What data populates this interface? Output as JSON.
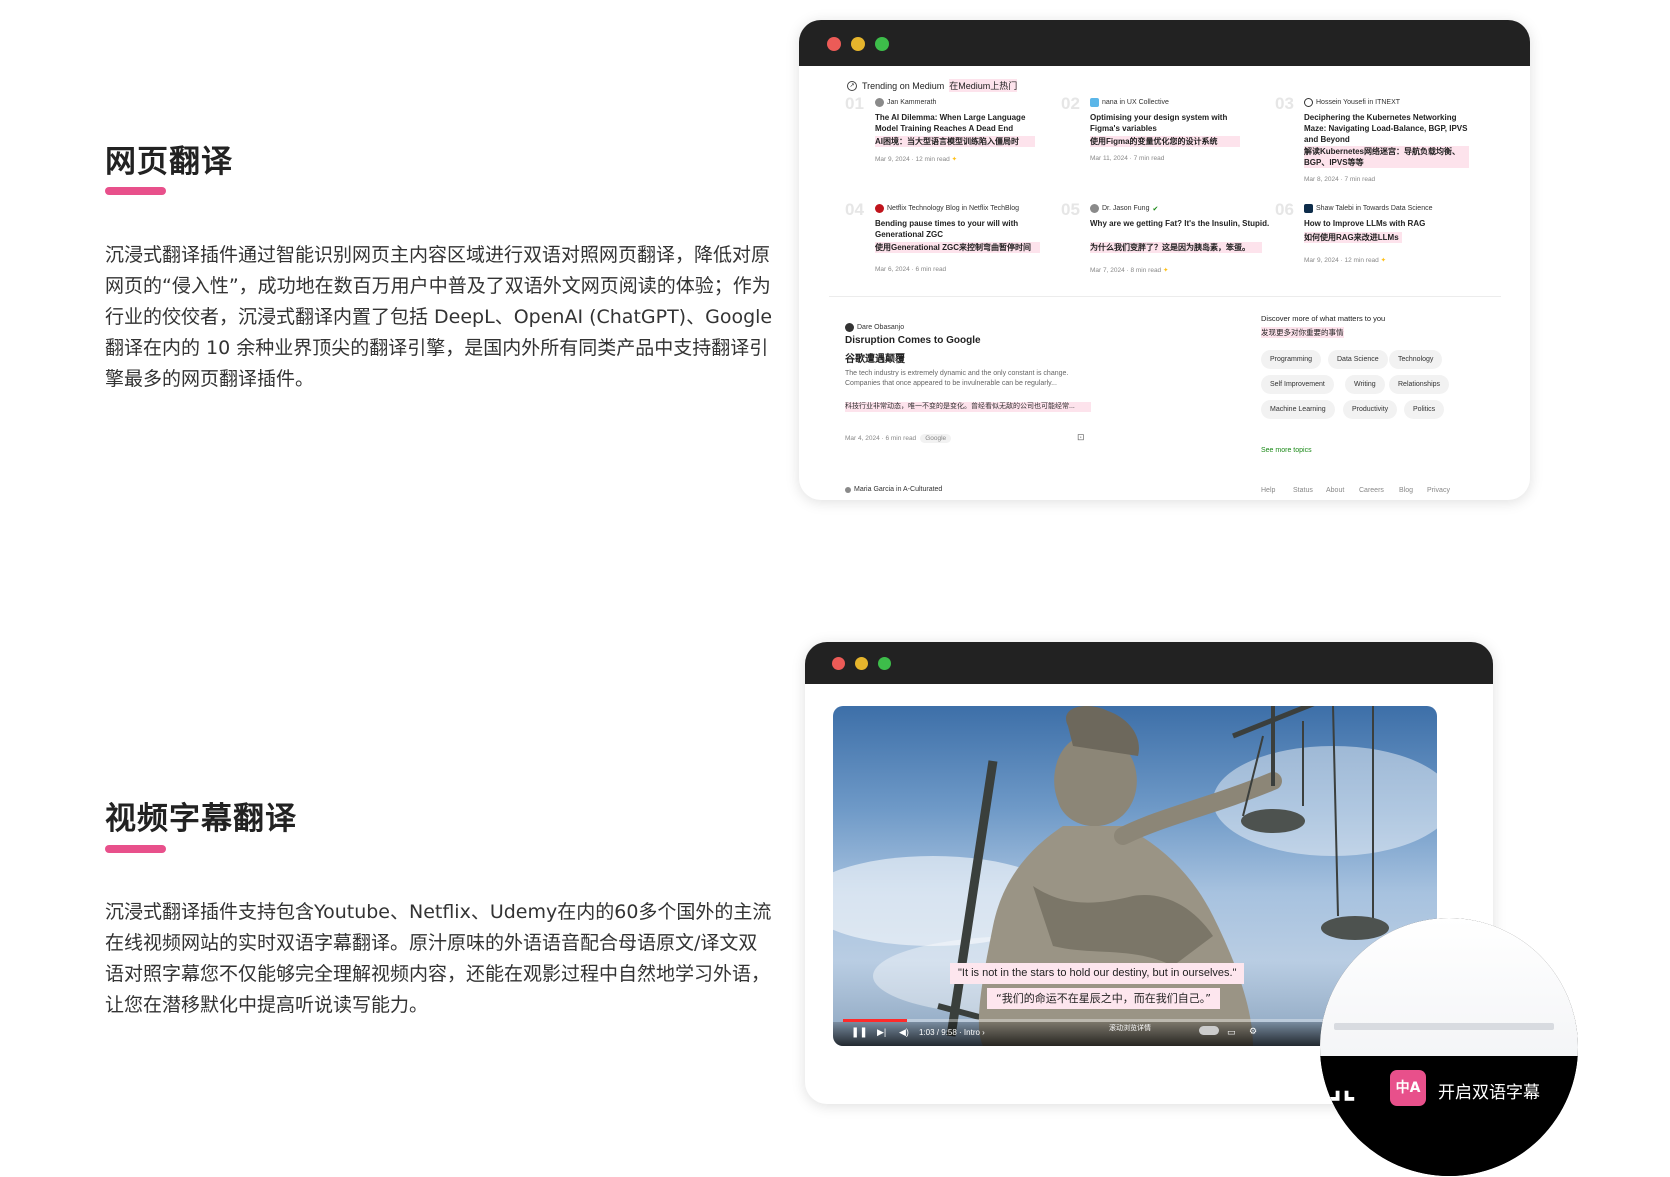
{
  "sections": {
    "web": {
      "title": "网页翻译",
      "desc": "沉浸式翻译插件通过智能识别网页主内容区域进行双语对照网页翻译，降低对原网页的“侵入性”，成功地在数百万用户中普及了双语外文网页阅读的体验；作为行业的佼佼者，沉浸式翻译内置了包括 DeepL、OpenAI (ChatGPT)、Google翻译在内的 10 余种业界顶尖的翻译引擎，是国内外所有同类产品中支持翻译引擎最多的网页翻译插件。"
    },
    "video": {
      "title": "视频字幕翻译",
      "desc": "沉浸式翻译插件支持包含Youtube、Netflix、Udemy在内的60多个国外的主流在线视频网站的实时双语字幕翻译。原汁原味的外语语音配合母语原文/译文双语对照字幕您不仅能够完全理解视频内容，还能在观影过程中自然地学习外语，让您在潜移默化中提高听说读写能力。"
    }
  },
  "colors": {
    "accent": "#e8508b",
    "window_bar": "#222222",
    "dot_red": "#ec5b57",
    "dot_yellow": "#e6b52c",
    "dot_green": "#3dbd4a",
    "highlight": "#fde3ec"
  },
  "medium": {
    "trending_label": "Trending on Medium",
    "trending_label_zh": "在Medium上热门",
    "articles": [
      {
        "num": "01",
        "author": "Jan Kammerath",
        "title": "The AI Dilemma: When Large Language Model Training Reaches A Dead End",
        "title_zh": "AI困境：当大型语言模型训练陷入僵局时",
        "meta": "Mar 9, 2024 · 12 min read"
      },
      {
        "num": "02",
        "author": "nana in UX Collective",
        "title": "Optimising your design system with Figma's variables",
        "title_zh": "使用Figma的变量优化您的设计系统",
        "meta": "Mar 11, 2024 · 7 min read"
      },
      {
        "num": "03",
        "author": "Hossein Yousefi in ITNEXT",
        "title": "Deciphering the Kubernetes Networking Maze: Navigating Load-Balance, BGP, IPVS and Beyond",
        "title_zh": "解读Kubernetes网络迷宫：导航负载均衡、BGP、IPVS等等",
        "meta": "Mar 8, 2024 · 7 min read"
      },
      {
        "num": "04",
        "author": "Netflix Technology Blog in Netflix TechBlog",
        "title": "Bending pause times to your will with Generational ZGC",
        "title_zh": "使用Generational ZGC来控制弯曲暂停时间",
        "meta": "Mar 6, 2024 · 6 min read"
      },
      {
        "num": "05",
        "author": "Dr. Jason Fung",
        "title": "Why are we getting Fat? It's the Insulin, Stupid.",
        "title_zh": "为什么我们变胖了？这是因为胰岛素，笨蛋。",
        "meta": "Mar 7, 2024 · 8 min read"
      },
      {
        "num": "06",
        "author": "Shaw Talebi in Towards Data Science",
        "title": "How to Improve LLMs with RAG",
        "title_zh": "如何使用RAG来改进LLMs",
        "meta": "Mar 9, 2024 · 12 min read"
      }
    ],
    "feature": {
      "author": "Dare Obasanjo",
      "title": "Disruption Comes to Google",
      "title_zh": "谷歌遭遇颠覆",
      "excerpt": "The tech industry is extremely dynamic and the only constant is change. Companies that once appeared to be invulnerable can be regularly...",
      "excerpt_zh": "科技行业非常动态，唯一不变的是变化。曾经看似无敌的公司也可能经常...",
      "meta": "Mar 4, 2024 · 6 min read",
      "tag": "Google"
    },
    "discover": {
      "title": "Discover more of what matters to you",
      "title_zh": "发现更多对你重要的事情",
      "topics": [
        "Programming",
        "Data Science",
        "Technology",
        "Self Improvement",
        "Writing",
        "Relationships",
        "Machine Learning",
        "Productivity",
        "Politics"
      ],
      "see_more": "See more topics"
    },
    "next_author": "Maria Garcia in A-Culturated",
    "footer": [
      "Help",
      "Status",
      "About",
      "Careers",
      "Blog",
      "Privacy"
    ]
  },
  "video_player": {
    "subtitle_en": "\"It is not in the stars to hold our destiny, but in ourselves.\"",
    "subtitle_zh": "“我们的命运不在星辰之中，而在我们自己。”",
    "time": "1:03 / 9:58 · Intro ›",
    "scroll_hint": "滚动浏览详情",
    "progress": 0.11,
    "toggle_label": "开启双语字幕",
    "logo_text": "中A"
  }
}
